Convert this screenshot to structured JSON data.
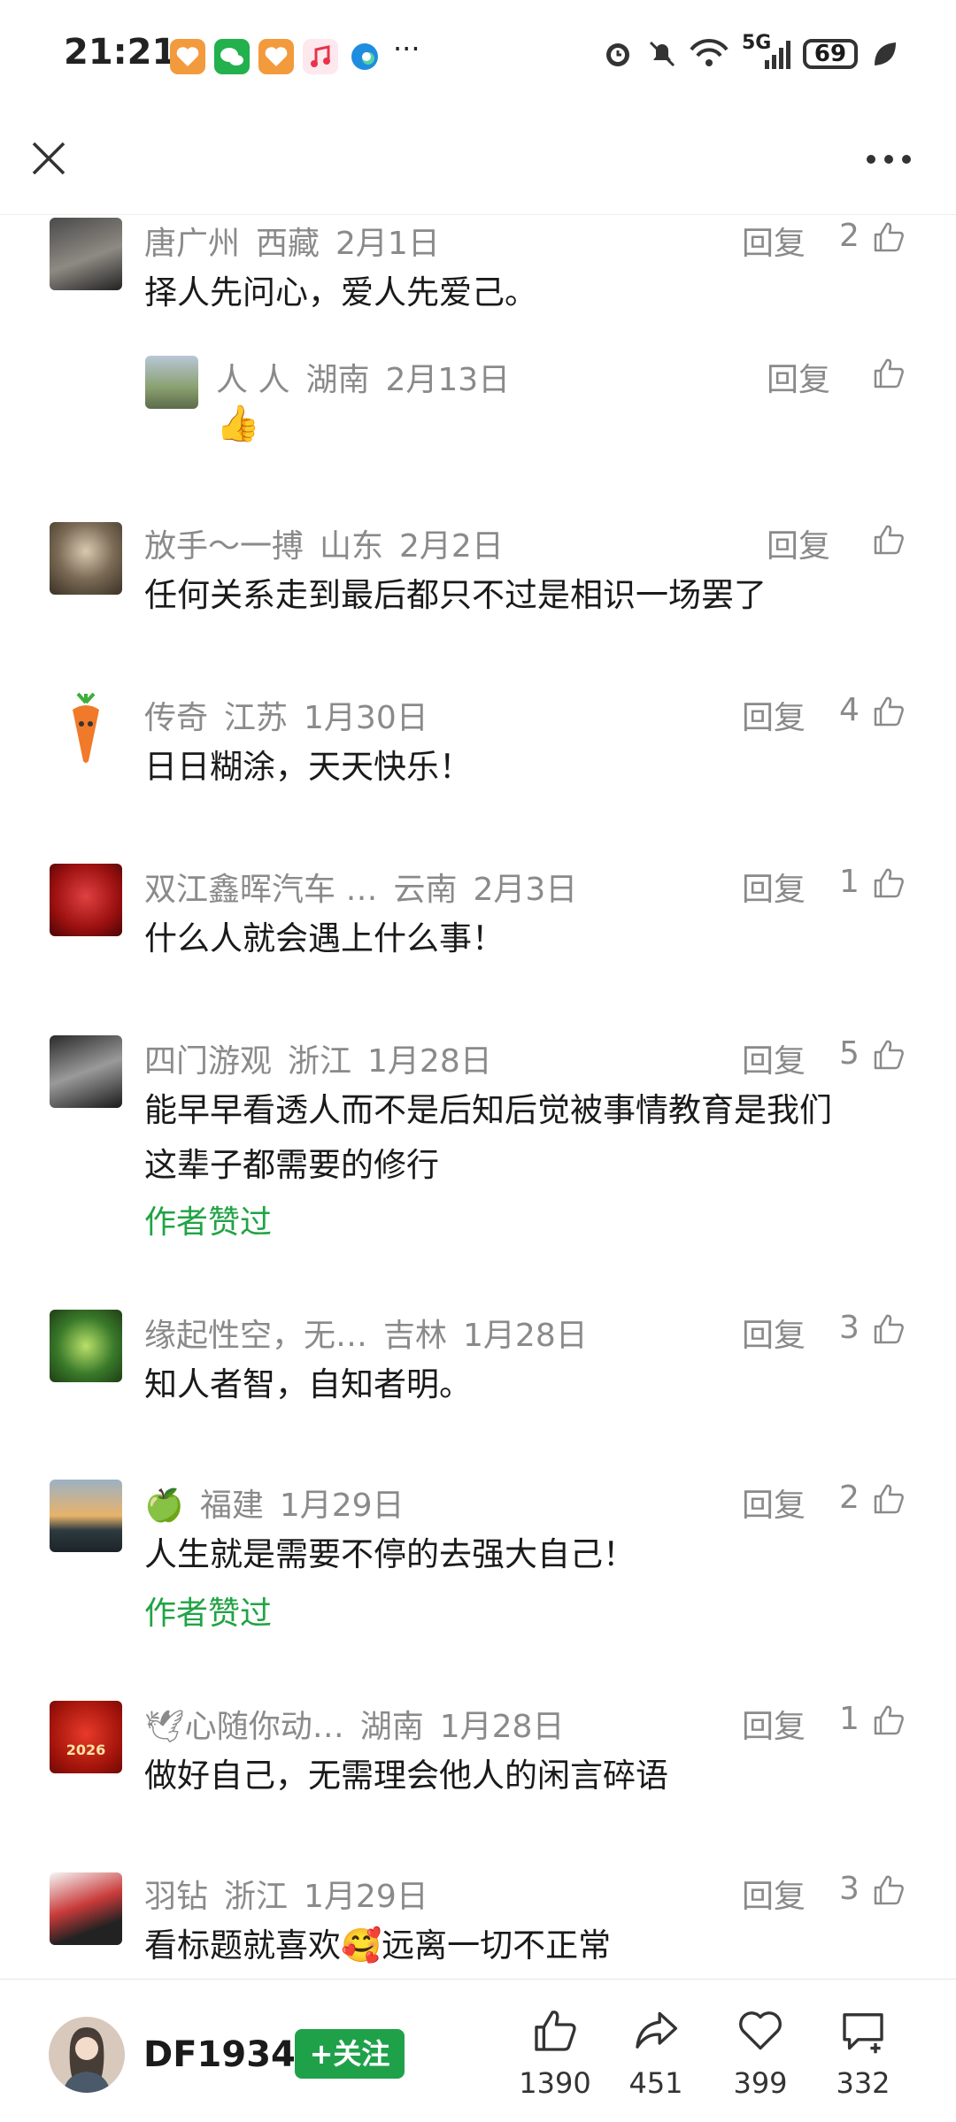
{
  "status_bar": {
    "time": "21:21",
    "signal": "5G",
    "battery": "69",
    "icons": [
      "heart-app-icon",
      "wechat-icon",
      "heart-app-icon",
      "music-icon",
      "edge-browser-icon",
      "more-dots-icon",
      "alarm-icon",
      "mute-icon",
      "wifi-icon",
      "signal-icon",
      "battery-icon",
      "leaf-icon"
    ]
  },
  "comments": [
    {
      "user": "唐广州",
      "region": "西藏",
      "date": "2月1日",
      "reply": "回复",
      "likes": "2",
      "text": "择人先问心，爱人先爱己。"
    },
    {
      "user": "人 人",
      "region": "湖南",
      "date": "2月13日",
      "reply": "回复",
      "likes": "",
      "text": "👍"
    },
    {
      "user": "放手～一搏",
      "region": "山东",
      "date": "2月2日",
      "reply": "回复",
      "likes": "",
      "text": "任何关系走到最后都只不过是相识一场罢了"
    },
    {
      "user": "传奇",
      "region": "江苏",
      "date": "1月30日",
      "reply": "回复",
      "likes": "4",
      "text": "日日糊涂，天天快乐！"
    },
    {
      "user": "双江鑫晖汽车 …",
      "region": "云南",
      "date": "2月3日",
      "reply": "回复",
      "likes": "1",
      "text": "什么人就会遇上什么事！"
    },
    {
      "user": "四门游观",
      "region": "浙江",
      "date": "1月28日",
      "reply": "回复",
      "likes": "5",
      "text_line1": "能早早看透人而不是后知后觉被事情教育是我们",
      "text_line2": "这辈子都需要的修行",
      "author_liked": "作者赞过"
    },
    {
      "user": "缘起性空，无…",
      "region": "吉林",
      "date": "1月28日",
      "reply": "回复",
      "likes": "3",
      "text": "知人者智，自知者明。"
    },
    {
      "user": "🍏",
      "region": "福建",
      "date": "1月29日",
      "reply": "回复",
      "likes": "2",
      "text": "人生就是需要不停的去强大自己！",
      "author_liked": "作者赞过"
    },
    {
      "user": "🕊心随你动…",
      "region": "湖南",
      "date": "1月28日",
      "reply": "回复",
      "likes": "1",
      "text": "做好自己，无需理会他人的闲言碎语",
      "avatar_text": "2026"
    },
    {
      "user": "羽钻",
      "region": "浙江",
      "date": "1月29日",
      "reply": "回复",
      "likes": "3",
      "text": "看标题就喜欢🥰远离一切不正常"
    }
  ],
  "bottom_bar": {
    "username": "DF1934",
    "follow_label": "+关注",
    "likes": "1390",
    "shares": "451",
    "favorites": "399",
    "comments": "332"
  },
  "colors": {
    "accent_green": "#1fa14a",
    "author_liked_green": "#21a345",
    "meta_gray": "#8a8a8a"
  }
}
